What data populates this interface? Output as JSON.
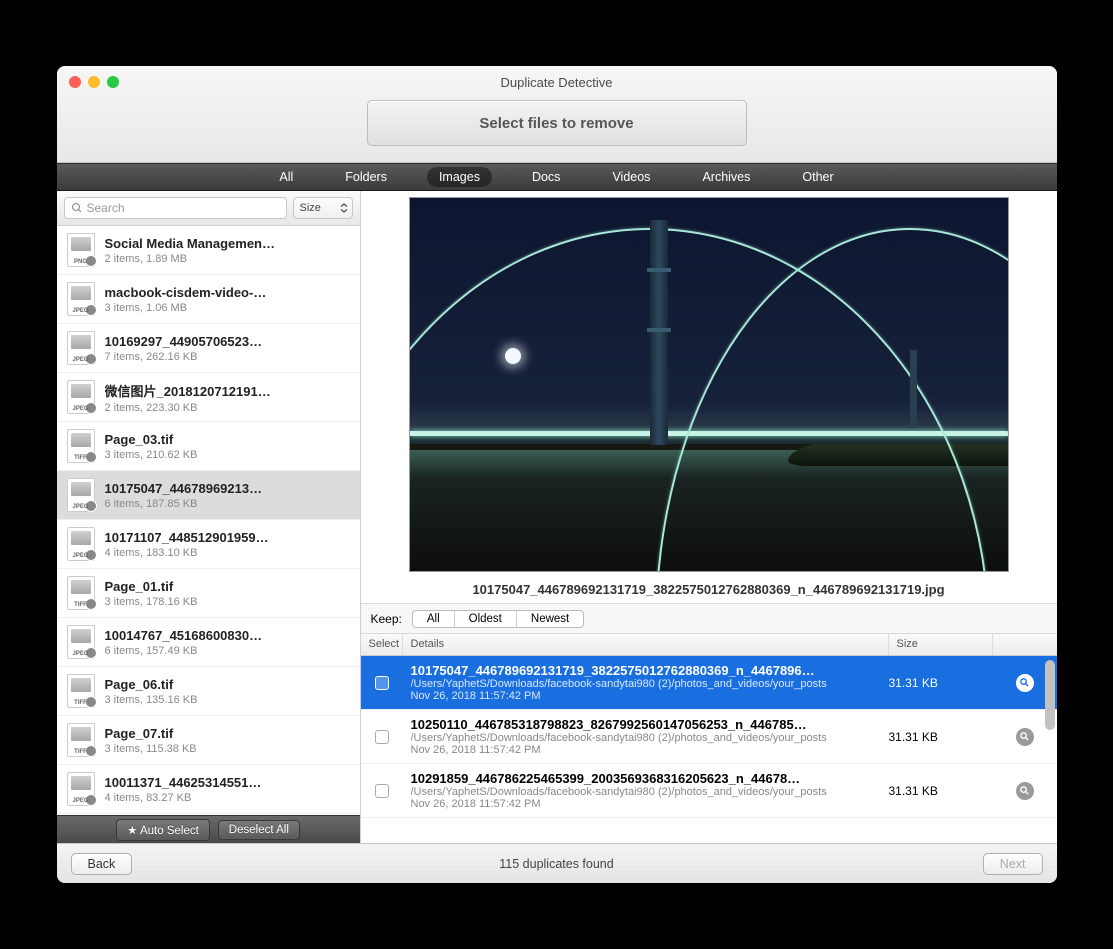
{
  "window": {
    "title": "Duplicate Detective",
    "banner": "Select files to remove"
  },
  "filters": {
    "items": [
      "All",
      "Folders",
      "Images",
      "Docs",
      "Videos",
      "Archives",
      "Other"
    ],
    "active": "Images"
  },
  "search": {
    "placeholder": "Search",
    "sort_label": "Size"
  },
  "groups": [
    {
      "name": "Social Media Managemen…",
      "meta": "2 items, 1.89 MB",
      "ext": "PNG",
      "selected": false
    },
    {
      "name": "macbook-cisdem-video-…",
      "meta": "3 items, 1.06 MB",
      "ext": "JPEG",
      "selected": false
    },
    {
      "name": "10169297_44905706523…",
      "meta": "7 items, 262.16 KB",
      "ext": "JPEG",
      "selected": false
    },
    {
      "name": "微信图片_2018120712191…",
      "meta": "2 items, 223.30 KB",
      "ext": "JPEG",
      "selected": false
    },
    {
      "name": "Page_03.tif",
      "meta": "3 items, 210.62 KB",
      "ext": "TIFF",
      "selected": false
    },
    {
      "name": "10175047_44678969213…",
      "meta": "6 items, 187.85 KB",
      "ext": "JPEG",
      "selected": true
    },
    {
      "name": "10171107_448512901959…",
      "meta": "4 items, 183.10 KB",
      "ext": "JPEG",
      "selected": false
    },
    {
      "name": "Page_01.tif",
      "meta": "3 items, 178.16 KB",
      "ext": "TIFF",
      "selected": false
    },
    {
      "name": "10014767_45168600830…",
      "meta": "6 items, 157.49 KB",
      "ext": "JPEG",
      "selected": false
    },
    {
      "name": "Page_06.tif",
      "meta": "3 items, 135.16 KB",
      "ext": "TIFF",
      "selected": false
    },
    {
      "name": "Page_07.tif",
      "meta": "3 items, 115.38 KB",
      "ext": "TIFF",
      "selected": false
    },
    {
      "name": "10011371_44625314551…",
      "meta": "4 items, 83.27 KB",
      "ext": "JPEG",
      "selected": false
    }
  ],
  "sidebar_actions": {
    "auto": "★ Auto Select",
    "deselect": "Deselect All"
  },
  "preview": {
    "filename": "10175047_446789692131719_3822575012762880369_n_446789692131719.jpg"
  },
  "keep": {
    "label": "Keep:",
    "options": [
      "All",
      "Oldest",
      "Newest"
    ]
  },
  "detail_headers": {
    "select": "Select",
    "details": "Details",
    "size": "Size"
  },
  "details": [
    {
      "name": "10175047_446789692131719_3822575012762880369_n_4467896…",
      "path": "/Users/YaphetS/Downloads/facebook-sandytai980 (2)/photos_and_videos/your_posts",
      "date": "Nov 26, 2018 11:57:42 PM",
      "size": "31.31 KB",
      "selected": true
    },
    {
      "name": "10250110_446785318798823_8267992560147056253_n_446785…",
      "path": "/Users/YaphetS/Downloads/facebook-sandytai980 (2)/photos_and_videos/your_posts",
      "date": "Nov 26, 2018 11:57:42 PM",
      "size": "31.31 KB",
      "selected": false
    },
    {
      "name": "10291859_446786225465399_2003569368316205623_n_44678…",
      "path": "/Users/YaphetS/Downloads/facebook-sandytai980 (2)/photos_and_videos/your_posts",
      "date": "Nov 26, 2018 11:57:42 PM",
      "size": "31.31 KB",
      "selected": false
    }
  ],
  "footer": {
    "back": "Back",
    "status": "115 duplicates found",
    "next": "Next"
  }
}
